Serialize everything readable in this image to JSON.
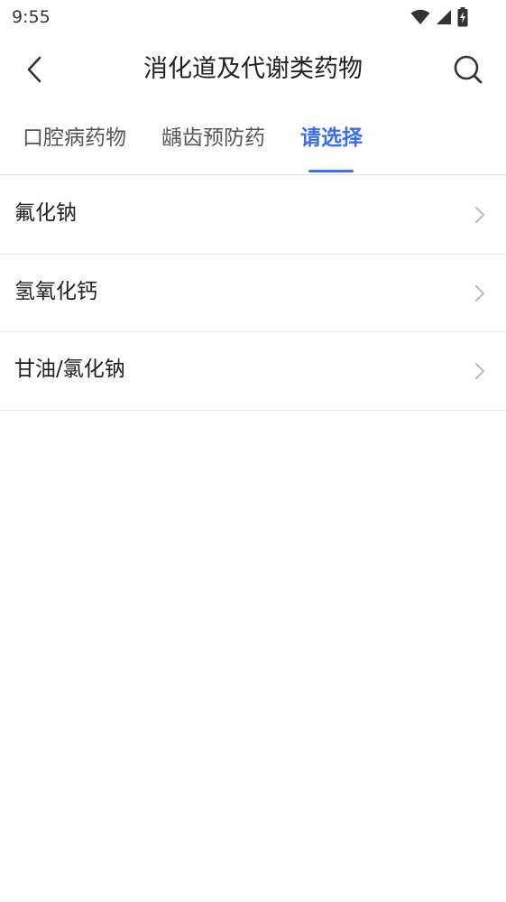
{
  "status_bar": {
    "time": "9:55",
    "icons": [
      "wifi-icon",
      "cellular-signal-icon",
      "battery-charging-icon"
    ]
  },
  "header": {
    "back_icon": "chevron-left-icon",
    "title": "消化道及代谢类药物",
    "search_icon": "search-icon"
  },
  "tabs": [
    {
      "label": "口腔病药物",
      "active": false
    },
    {
      "label": "龋齿预防药",
      "active": false
    },
    {
      "label": "请选择",
      "active": true
    }
  ],
  "list": {
    "items": [
      {
        "label": "氟化钠"
      },
      {
        "label": "氢氧化钙"
      },
      {
        "label": "甘油/氯化钠"
      }
    ],
    "chevron_icon": "chevron-right-icon"
  },
  "colors": {
    "accent": "#3c6ef2",
    "text_primary": "#222222",
    "text_secondary": "#555555",
    "divider": "#ececec",
    "chevron": "#bbbbbb"
  }
}
